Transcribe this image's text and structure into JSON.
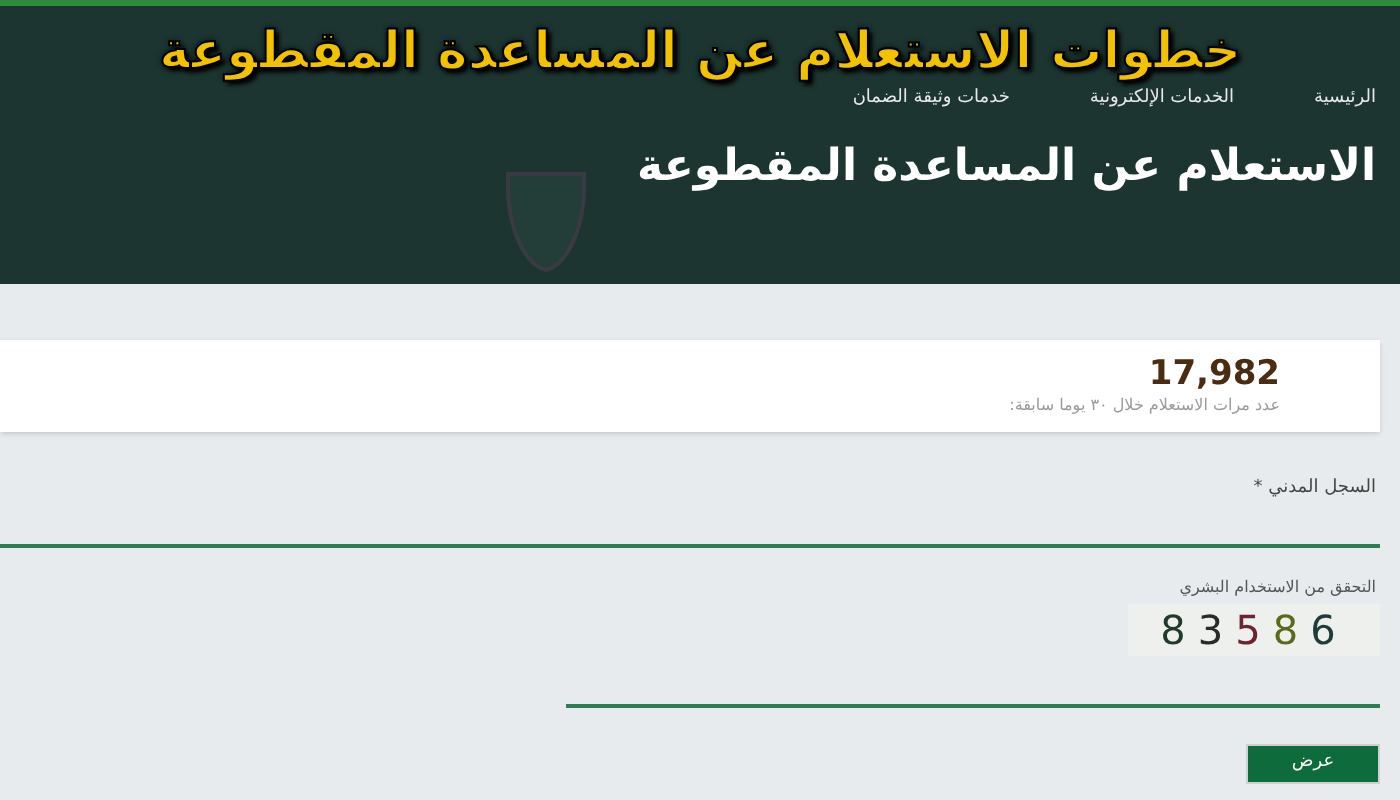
{
  "overlay_title": "خطوات الاستعلام عن المساعدة المقطوعة",
  "nav": [
    "الرئيسية",
    "الخدمات الإلكترونية",
    "خدمات وثيقة الضمان"
  ],
  "page_title": "الاستعلام عن المساعدة المقطوعة",
  "stats": {
    "value": "17,982",
    "caption": "عدد مرات الاستعلام خلال ٣٠ يوما سابقة:"
  },
  "form": {
    "civil_id_label": "السجل المدني *",
    "captcha_label": "التحقق من الاستخدام البشري",
    "captcha": "83586",
    "submit": "عرض"
  }
}
